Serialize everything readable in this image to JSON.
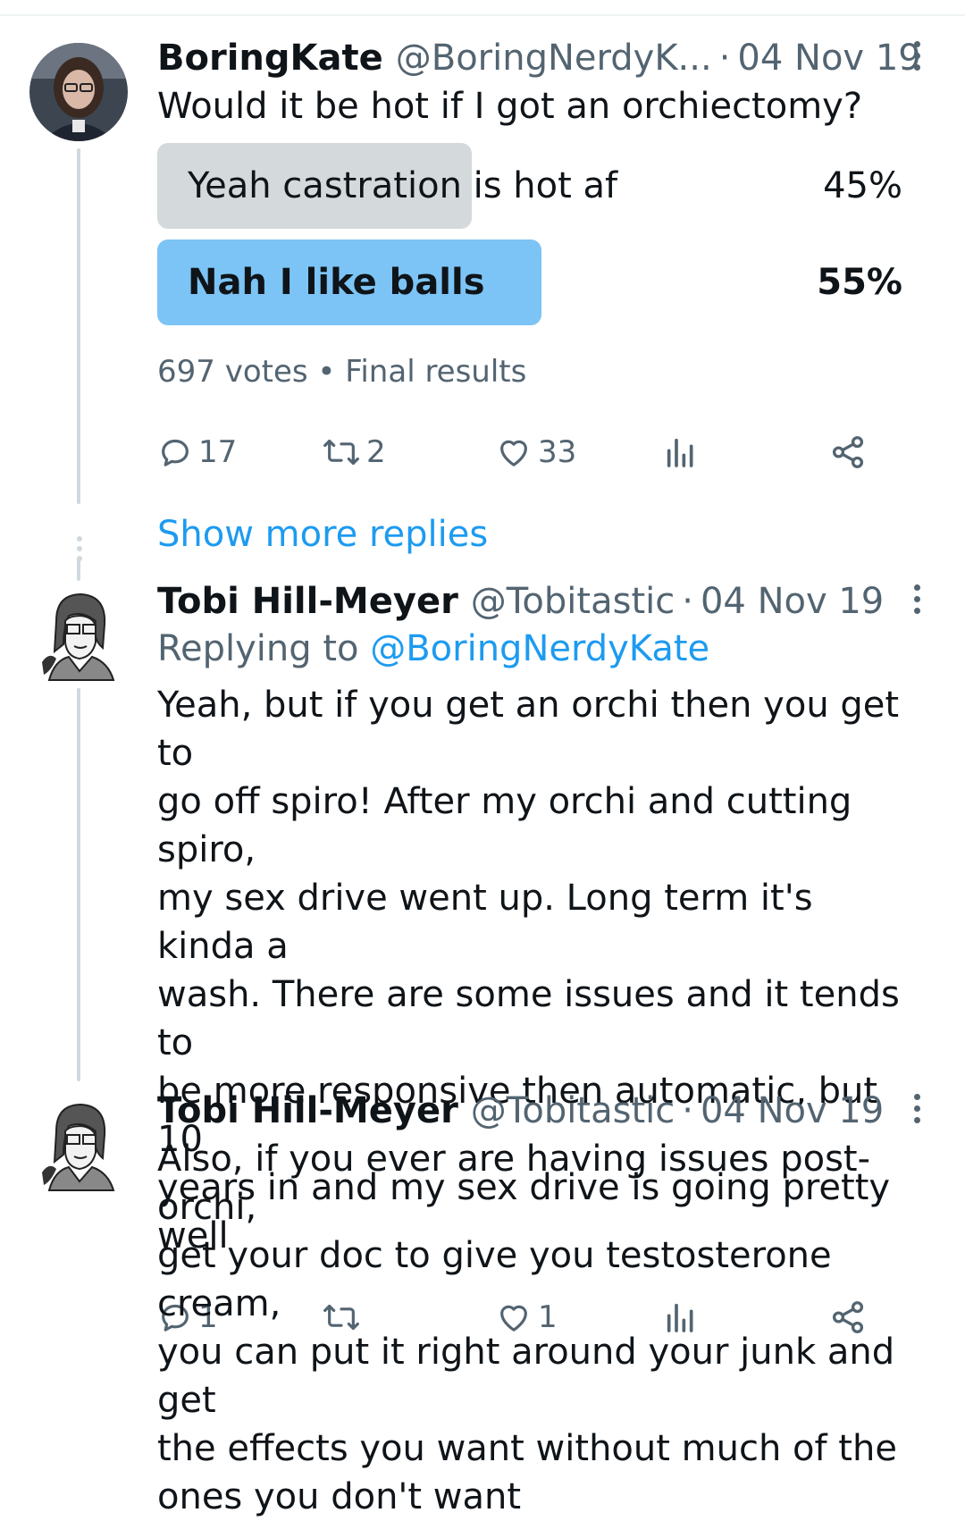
{
  "show_more_replies": "Show more replies",
  "tweets": [
    {
      "name": "BoringKate",
      "handle": "@BoringNerdyK...",
      "dot": "·",
      "date": "04 Nov 19",
      "text": "Would it be hot if I got an orchiectomy?",
      "poll": {
        "options": [
          {
            "label": "Yeah castration is hot af",
            "percent_text": "45%",
            "percent": 45,
            "winner": false
          },
          {
            "label": "Nah I like balls",
            "percent_text": "55%",
            "percent": 55,
            "winner": true
          }
        ],
        "votes": "697 votes",
        "sep": "•",
        "status": "Final results"
      },
      "actions": {
        "replies": "17",
        "reposts": "2",
        "likes": "33",
        "views": ""
      }
    },
    {
      "name": "Tobi Hill-Meyer",
      "handle": "@Tobitastic",
      "dot": "·",
      "date": "04 Nov 19",
      "replying_prefix": "Replying to",
      "replying_to": "@BoringNerdyKate",
      "text_lines": [
        "Yeah, but if you get an orchi then you get to",
        "go off spiro! After my orchi and cutting spiro,",
        "my sex drive went up. Long term it's kinda a",
        "wash. There are some issues and it tends to",
        "be more responsive then automatic, but 10",
        "years in and my sex drive is going pretty well"
      ],
      "actions": {
        "replies": "1",
        "reposts": "",
        "likes": "1",
        "views": ""
      }
    },
    {
      "name": "Tobi Hill-Meyer",
      "handle": "@Tobitastic",
      "dot": "·",
      "date": "04 Nov 19",
      "text_lines": [
        "Also, if you ever are having issues post-orchi,",
        "get your doc to give you testosterone cream,",
        "you can put it right around your junk and get",
        "the effects you want without much of the",
        "ones you don't want"
      ]
    }
  ],
  "colors": {
    "accent": "#1d9bf0",
    "poll_winner": "#7cc4f5",
    "poll_loser": "#d4d9dc",
    "muted": "#536471",
    "thread_line": "#cfd9de"
  }
}
